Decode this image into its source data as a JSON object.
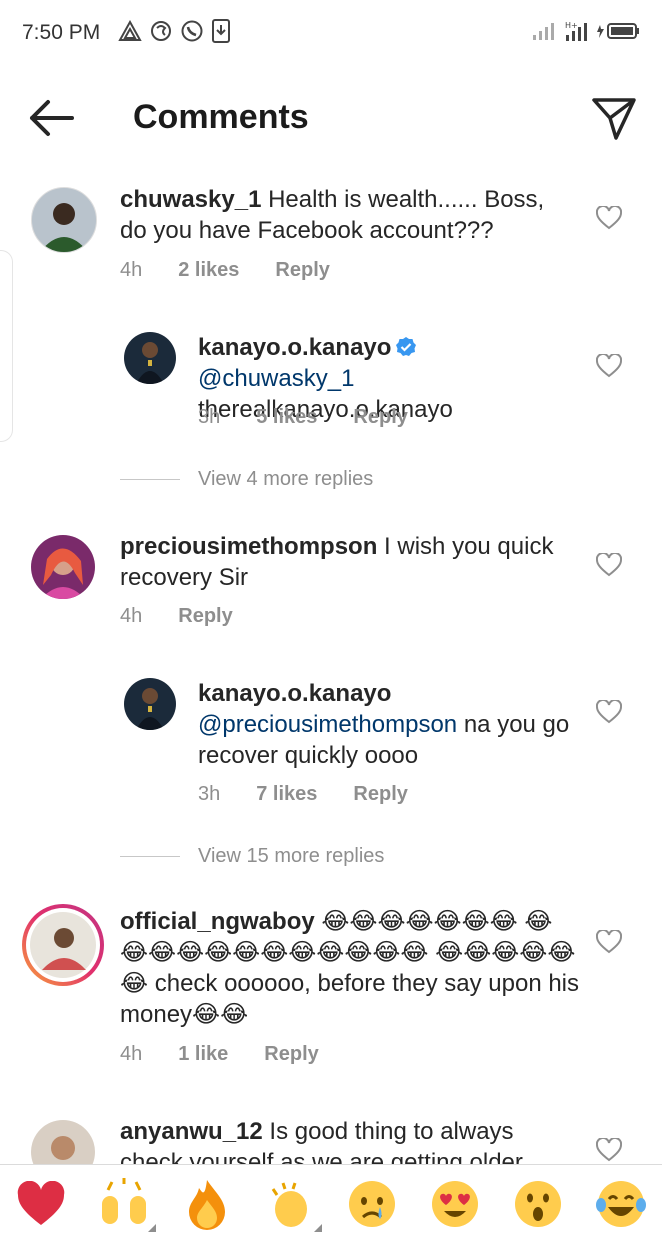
{
  "status": {
    "time": "7:50 PM"
  },
  "header": {
    "title": "Comments"
  },
  "comments": [
    {
      "username": "chuwasky_1",
      "text": "Health is wealth...... Boss, do you have Facebook account???",
      "time": "4h",
      "likes": "2 likes",
      "reply": "Reply"
    },
    {
      "username": "kanayo.o.kanayo",
      "mention": "@chuwasky_1",
      "text": "therealkanayo.o.kanayo",
      "time": "3h",
      "likes": "5 likes",
      "reply": "Reply"
    },
    {
      "view_more": "View 4 more replies"
    },
    {
      "username": "preciousimethompson",
      "text": "I wish you quick recovery Sir",
      "time": "4h",
      "reply": "Reply"
    },
    {
      "username": "kanayo.o.kanayo",
      "mention": "@preciousimethompson",
      "text": "na you go recover quickly oooo",
      "time": "3h",
      "likes": "7 likes",
      "reply": "Reply"
    },
    {
      "view_more": "View 15 more replies"
    },
    {
      "username": "official_ngwaboy",
      "emoji_line1": "😂😂😂😂😂😂😂",
      "emoji_line2": "😂😂😂😂😂😂😂😂😂😂😂😂",
      "emoji_line3": "😂😂😂😂😂😂",
      "text": "check oooooo, before they say upon his money",
      "text_end": "😂😂",
      "time": "4h",
      "likes": "1 like",
      "reply": "Reply"
    },
    {
      "username": "anyanwu_12",
      "text": "Is good thing to always check yourself as we are getting older"
    }
  ],
  "emoji_bar": [
    "❤️",
    "🙌",
    "🔥",
    "👏",
    "😢",
    "😍",
    "😮",
    "😂"
  ]
}
